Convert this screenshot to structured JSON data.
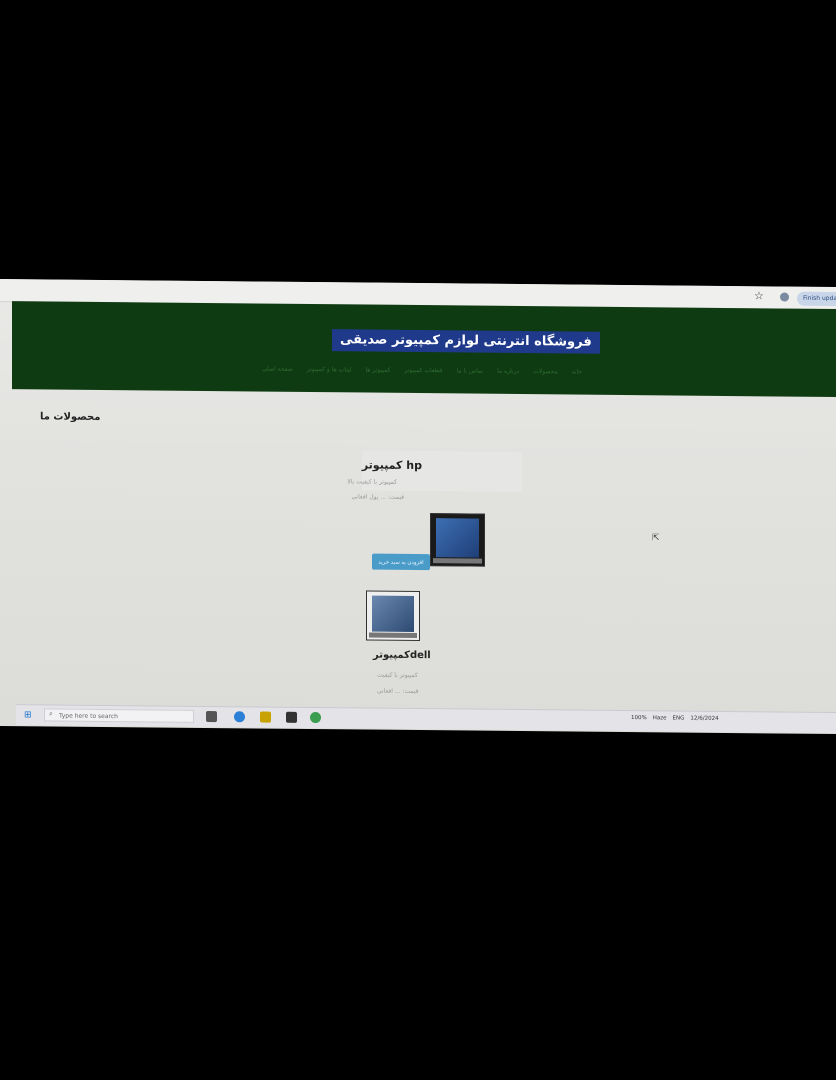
{
  "browser": {
    "update_label": "Finish update"
  },
  "site": {
    "title": "فروشگاه انترنتی لوازم کمپیوتر صدیقی",
    "nav": [
      "صفحه اصلی",
      "لپتاپ ها و کمپیوتر",
      "کمپیوتر ها",
      "قطعات کمپیوتر",
      "تماس با ما",
      "درباره ما",
      "محصولات",
      "خانه"
    ]
  },
  "products": {
    "heading": "محصولات ما",
    "items": [
      {
        "name": "hp کمپیوتر",
        "description": "کمپیوتر با کیفیت بالا",
        "price": "قیمت: ... پول افغانی",
        "button": "افزودن به سبد خرید"
      },
      {
        "name": "dellکمپیوتر",
        "description": "کمپیوتر با کیفیت",
        "price": "قیمت: ... افغانی"
      }
    ]
  },
  "taskbar": {
    "search_placeholder": "Type here to search",
    "zoom": "100%",
    "weather": "Haze",
    "lang": "ENG",
    "date": "12/6/2024"
  },
  "colors": {
    "header_bg": "#0f3b12",
    "title_highlight": "#1f3a8a",
    "button_bg": "#4a9cc8"
  }
}
